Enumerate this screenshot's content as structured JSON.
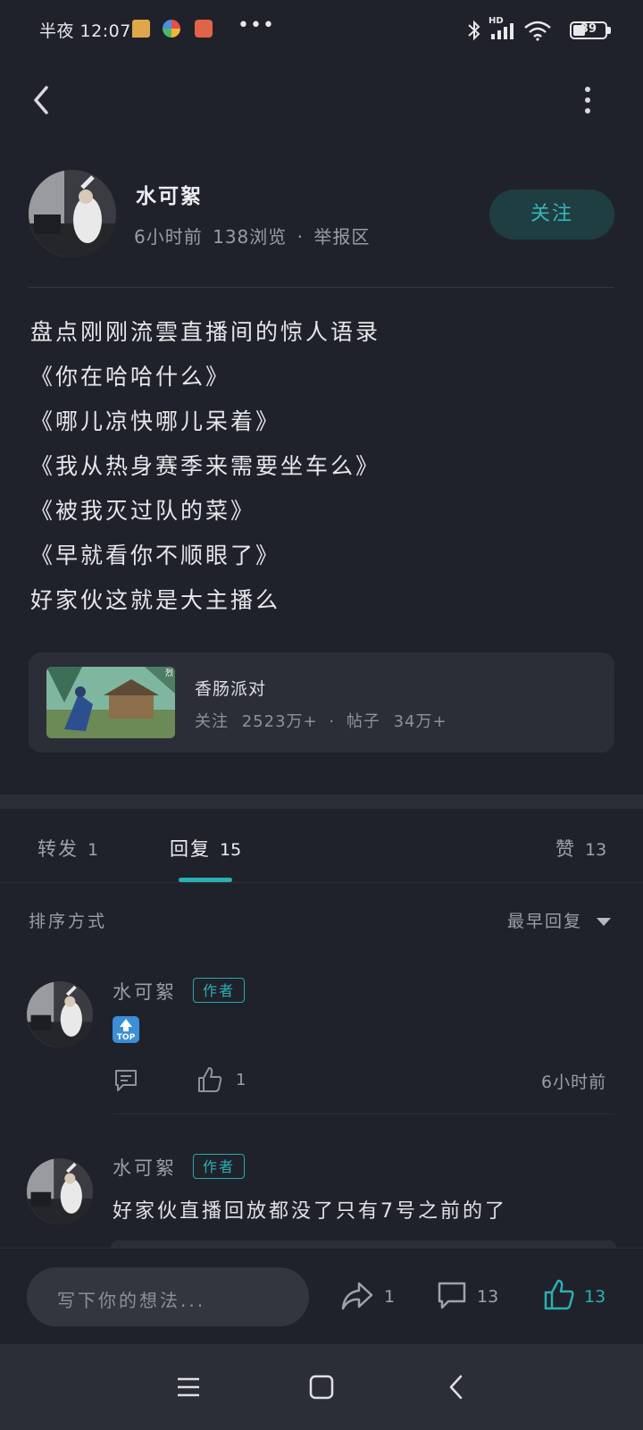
{
  "status_bar": {
    "time": "半夜 12:07",
    "dots": "•••",
    "battery": "39",
    "network_label": "HD"
  },
  "post": {
    "author": "水可絮",
    "time_ago": "6小时前",
    "views": "138浏览",
    "separator": "·",
    "zone": "举报区",
    "follow_label": "关注",
    "lines": [
      "盘点刚刚流雲直播间的惊人语录",
      "《你在哈哈什么》",
      "《哪儿凉快哪儿呆着》",
      "《我从热身赛季来需要坐车么》",
      "《被我灭过队的菜》",
      "《早就看你不顺眼了》",
      "好家伙这就是大主播么"
    ]
  },
  "topic": {
    "name": "香肠派对",
    "follow_label": "关注",
    "follow_count": "2523万+",
    "dot": "·",
    "posts_label": "帖子",
    "posts_count": "34万+",
    "thumb_badge": "烈"
  },
  "tabs": [
    {
      "label": "转发",
      "count": "1"
    },
    {
      "label": "回复",
      "count": "15"
    },
    {
      "label": "赞",
      "count": "13"
    }
  ],
  "sort": {
    "label": "排序方式",
    "value": "最早回复"
  },
  "comments": [
    {
      "author": "水可絮",
      "badge": "作者",
      "emoji_text": "TOP",
      "likes": "1",
      "time": "6小时前"
    },
    {
      "author": "水可絮",
      "badge": "作者",
      "text": "好家伙直播回放都没了只有7号之前的了"
    }
  ],
  "bottom_bar": {
    "placeholder": "写下你的想法...",
    "share_count": "1",
    "comment_count": "13",
    "like_count": "13"
  },
  "colors": {
    "background": "#20222b",
    "accent": "#2ab0b2",
    "card": "#2b2e37"
  }
}
